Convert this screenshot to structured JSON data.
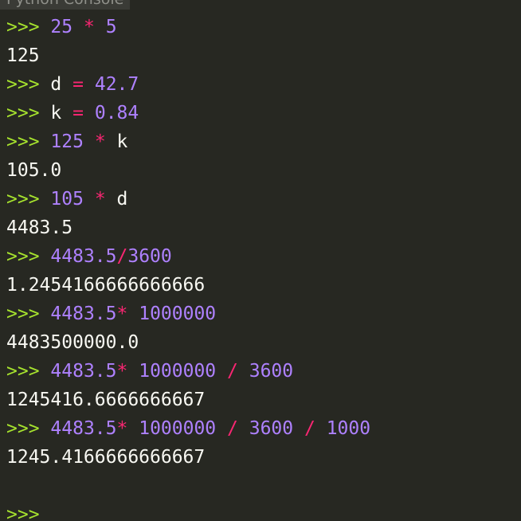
{
  "window": {
    "title": "Python Console"
  },
  "console": {
    "prompt": ">>>",
    "lines": [
      {
        "type": "input",
        "tokens": [
          {
            "k": "num",
            "t": "25"
          },
          {
            "k": "ws",
            "t": " "
          },
          {
            "k": "op",
            "t": "*"
          },
          {
            "k": "ws",
            "t": " "
          },
          {
            "k": "num",
            "t": "5"
          }
        ]
      },
      {
        "type": "output",
        "text": "125"
      },
      {
        "type": "input",
        "tokens": [
          {
            "k": "ident",
            "t": "d"
          },
          {
            "k": "ws",
            "t": " "
          },
          {
            "k": "op",
            "t": "="
          },
          {
            "k": "ws",
            "t": " "
          },
          {
            "k": "num",
            "t": "42.7"
          }
        ]
      },
      {
        "type": "input",
        "tokens": [
          {
            "k": "ident",
            "t": "k"
          },
          {
            "k": "ws",
            "t": " "
          },
          {
            "k": "op",
            "t": "="
          },
          {
            "k": "ws",
            "t": " "
          },
          {
            "k": "num",
            "t": "0.84"
          }
        ]
      },
      {
        "type": "input",
        "tokens": [
          {
            "k": "num",
            "t": "125"
          },
          {
            "k": "ws",
            "t": " "
          },
          {
            "k": "op",
            "t": "*"
          },
          {
            "k": "ws",
            "t": " "
          },
          {
            "k": "ident",
            "t": "k"
          }
        ]
      },
      {
        "type": "output",
        "text": "105.0"
      },
      {
        "type": "input",
        "tokens": [
          {
            "k": "num",
            "t": "105"
          },
          {
            "k": "ws",
            "t": " "
          },
          {
            "k": "op",
            "t": "*"
          },
          {
            "k": "ws",
            "t": " "
          },
          {
            "k": "ident",
            "t": "d"
          }
        ]
      },
      {
        "type": "output",
        "text": "4483.5"
      },
      {
        "type": "input",
        "tokens": [
          {
            "k": "num",
            "t": "4483.5"
          },
          {
            "k": "op",
            "t": "/"
          },
          {
            "k": "num",
            "t": "3600"
          }
        ]
      },
      {
        "type": "output",
        "text": "1.2454166666666666"
      },
      {
        "type": "input",
        "tokens": [
          {
            "k": "num",
            "t": "4483.5"
          },
          {
            "k": "op",
            "t": "*"
          },
          {
            "k": "ws",
            "t": " "
          },
          {
            "k": "num",
            "t": "1000000"
          }
        ]
      },
      {
        "type": "output",
        "text": "4483500000.0"
      },
      {
        "type": "input",
        "tokens": [
          {
            "k": "num",
            "t": "4483.5"
          },
          {
            "k": "op",
            "t": "*"
          },
          {
            "k": "ws",
            "t": " "
          },
          {
            "k": "num",
            "t": "1000000"
          },
          {
            "k": "ws",
            "t": " "
          },
          {
            "k": "op",
            "t": "/"
          },
          {
            "k": "ws",
            "t": " "
          },
          {
            "k": "num",
            "t": "3600"
          }
        ]
      },
      {
        "type": "output",
        "text": "1245416.6666666667"
      },
      {
        "type": "input",
        "tokens": [
          {
            "k": "num",
            "t": "4483.5"
          },
          {
            "k": "op",
            "t": "*"
          },
          {
            "k": "ws",
            "t": " "
          },
          {
            "k": "num",
            "t": "1000000"
          },
          {
            "k": "ws",
            "t": " "
          },
          {
            "k": "op",
            "t": "/"
          },
          {
            "k": "ws",
            "t": " "
          },
          {
            "k": "num",
            "t": "3600"
          },
          {
            "k": "ws",
            "t": " "
          },
          {
            "k": "op",
            "t": "/"
          },
          {
            "k": "ws",
            "t": " "
          },
          {
            "k": "num",
            "t": "1000"
          }
        ]
      },
      {
        "type": "output",
        "text": "1245.4166666666667"
      },
      {
        "type": "blank"
      },
      {
        "type": "prompt-only"
      }
    ]
  },
  "colors": {
    "background": "#272822",
    "prompt": "#a6e22e",
    "number": "#ae81ff",
    "operator": "#f92672",
    "text": "#f8f8f2"
  }
}
